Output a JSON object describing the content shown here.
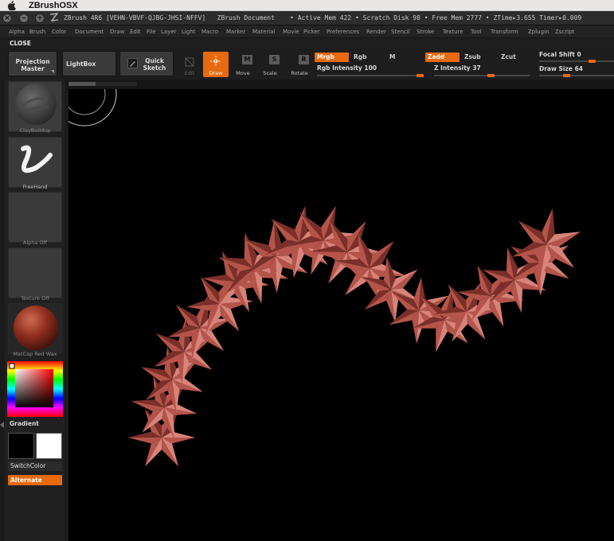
{
  "os_menu": {
    "app_name": "ZBrushOSX"
  },
  "titlebar": {
    "text": "ZBrush 4R6 [VEHN-VBVF-QJBG-JHSI-NFFV]   ZBrush Document    • Active Mem 422 • Scratch Disk 98 • Free Mem 2777 • ZTime▸3.655 Timer▸0.009"
  },
  "menu": {
    "items": [
      "Alpha",
      "Brush",
      "Color",
      "Document",
      "Draw",
      "Edit",
      "File",
      "Layer",
      "Light",
      "Macro",
      "Marker",
      "Material",
      "Movie",
      "Picker",
      "Preferences",
      "Render",
      "Stencil",
      "Stroke",
      "Texture",
      "Tool",
      "Transform",
      "Zplugin",
      "Zscript"
    ]
  },
  "closebar": {
    "label": "CLOSE"
  },
  "shelf": {
    "projection_master": "Projection Master",
    "lightbox": "LightBox",
    "quick_sketch": "Quick Sketch",
    "edit": "Edit",
    "draw": "Draw",
    "move": "Move",
    "scale": "Scale",
    "rotate": "Rotate",
    "mrgb": "Mrgb",
    "rgb": "Rgb",
    "m": "M",
    "zadd": "Zadd",
    "zsub": "Zsub",
    "zcut": "Zcut",
    "rgb_intensity_label": "Rgb Intensity",
    "rgb_intensity_value": "100",
    "rgb_intensity": 1.0,
    "z_intensity_label": "Z Intensity",
    "z_intensity_value": "37",
    "z_intensity": 0.37,
    "focal_shift_label": "Focal Shift",
    "focal_shift_value": "0",
    "draw_size_label": "Draw Size",
    "draw_size_value": "64"
  },
  "lefttray": {
    "brush_label": "ClayBuildup",
    "stroke_label": "FreeHand",
    "alpha_label": "Alpha  Off",
    "texture_label": "Texture  Off",
    "material_label": "MatCap Red Wax",
    "gradient_label": "Gradient",
    "switch_color": "SwitchColor",
    "alternate": "Alternate"
  },
  "colors": {
    "accent": "#e8690e",
    "star_fill": "#b5544a",
    "star_shadow": "#7a3028",
    "star_highlight": "#d8837a"
  }
}
